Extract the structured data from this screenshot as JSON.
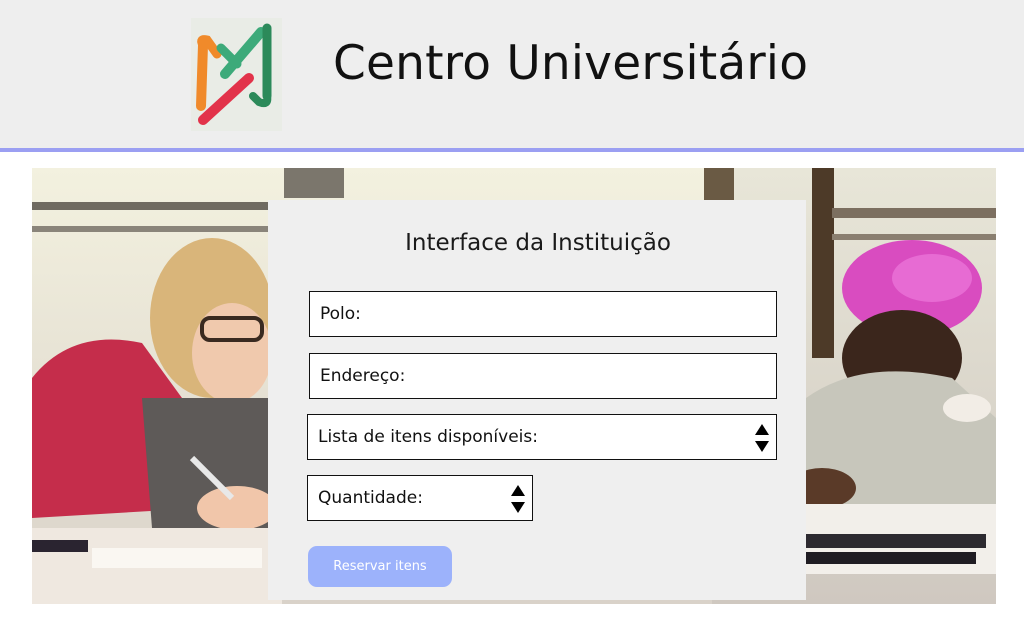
{
  "header": {
    "title": "Centro Universitário",
    "logo_icon": "university-logo"
  },
  "hero": {
    "image": "students-writing-photo"
  },
  "form": {
    "title": "Interface da Instituição",
    "polo_label": "Polo:",
    "endereco_label": "Endereço:",
    "items_label": "Lista de itens disponíveis:",
    "quantity_label": "Quantidade:",
    "submit_label": "Reservar itens"
  },
  "colors": {
    "header_bg": "#eeeeee",
    "header_rule": "#9b9ff2",
    "panel_bg": "#efefef",
    "button_bg": "#9cb2fb"
  }
}
